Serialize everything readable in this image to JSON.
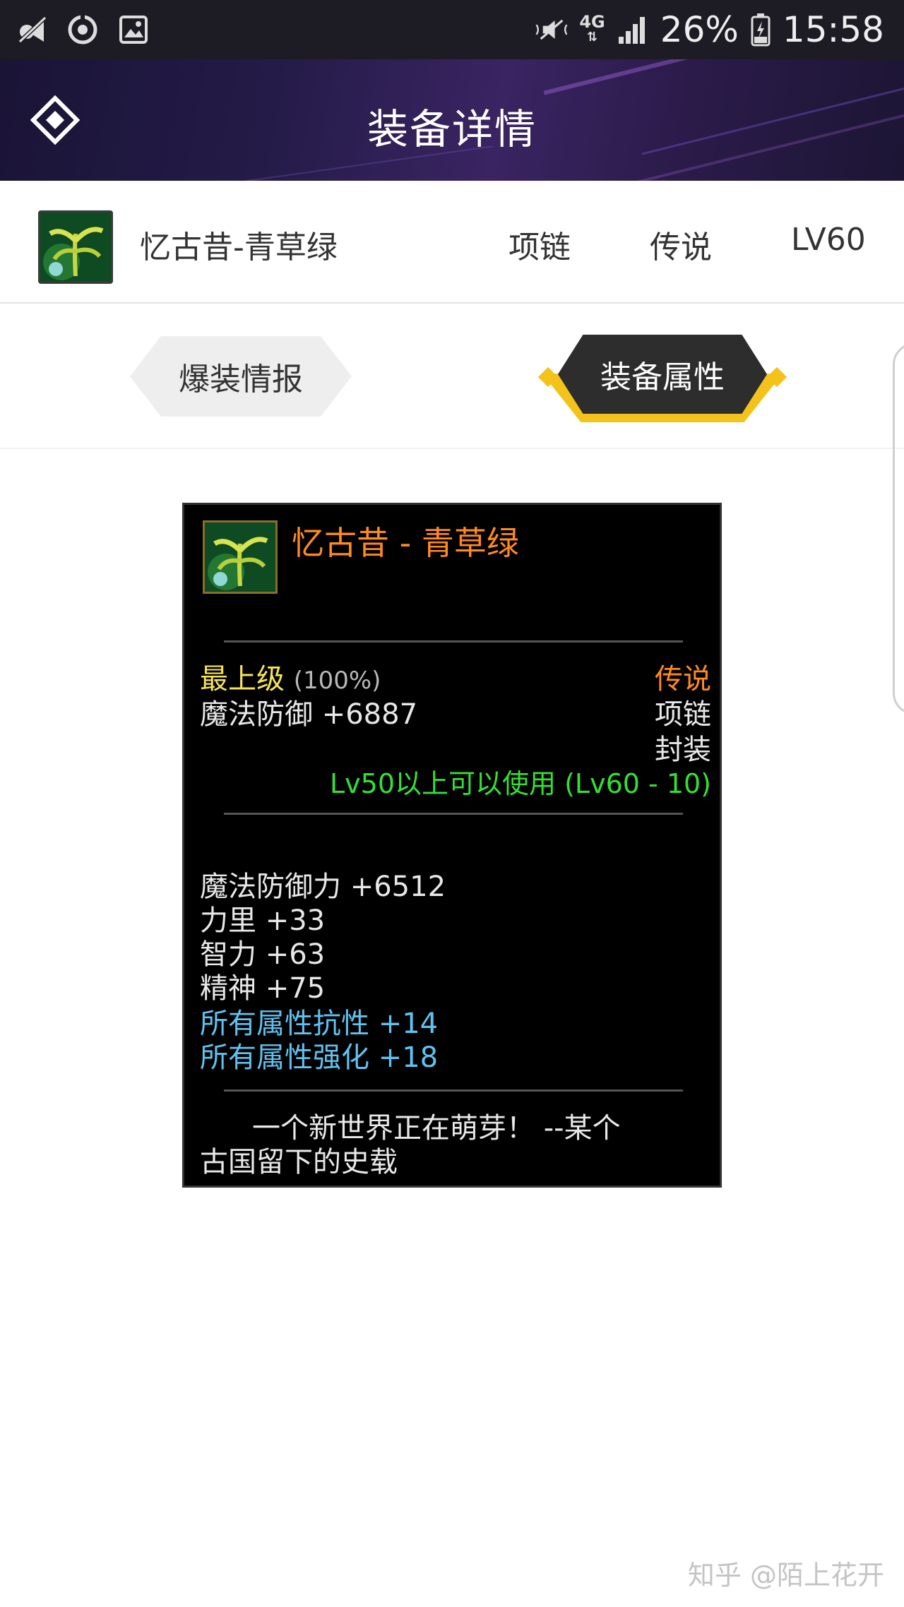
{
  "status_bar": {
    "network": "4G",
    "battery": "26%",
    "time": "15:58"
  },
  "header": {
    "title": "装备详情"
  },
  "item": {
    "name": "忆古昔-青草绿",
    "type": "项链",
    "rarity": "传说",
    "level": "LV60"
  },
  "tabs": [
    {
      "label": "爆装情报",
      "active": false
    },
    {
      "label": "装备属性",
      "active": true
    }
  ],
  "tooltip": {
    "title": "忆古昔 - 青草绿",
    "grade": "最上级",
    "grade_percent": "(100%)",
    "rarity": "传说",
    "base_stat": "魔法防御 +6887",
    "type": "项链",
    "seal": "封装",
    "requirement": "Lv50以上可以使用 (Lv60 - 10)",
    "stats": [
      {
        "text": "魔法防御力 +6512",
        "color": "white"
      },
      {
        "text": "力里 +33",
        "color": "white"
      },
      {
        "text": "智力 +63",
        "color": "white"
      },
      {
        "text": "精神 +75",
        "color": "white"
      },
      {
        "text": "所有属性抗性 +14",
        "color": "cyan"
      },
      {
        "text": "所有属性强化 +18",
        "color": "cyan"
      }
    ],
    "flavor_line1": "一个新世界正在萌芽！ --某个",
    "flavor_line2": "古国留下的史载"
  },
  "watermark": "知乎 @陌上花开",
  "colors": {
    "title_orange": "#ff8a1e",
    "grade_yellow": "#f6e35a",
    "requirement_green": "#34e034",
    "special_cyan": "#5fc2f0",
    "tab_gold": "#f3c31b"
  }
}
